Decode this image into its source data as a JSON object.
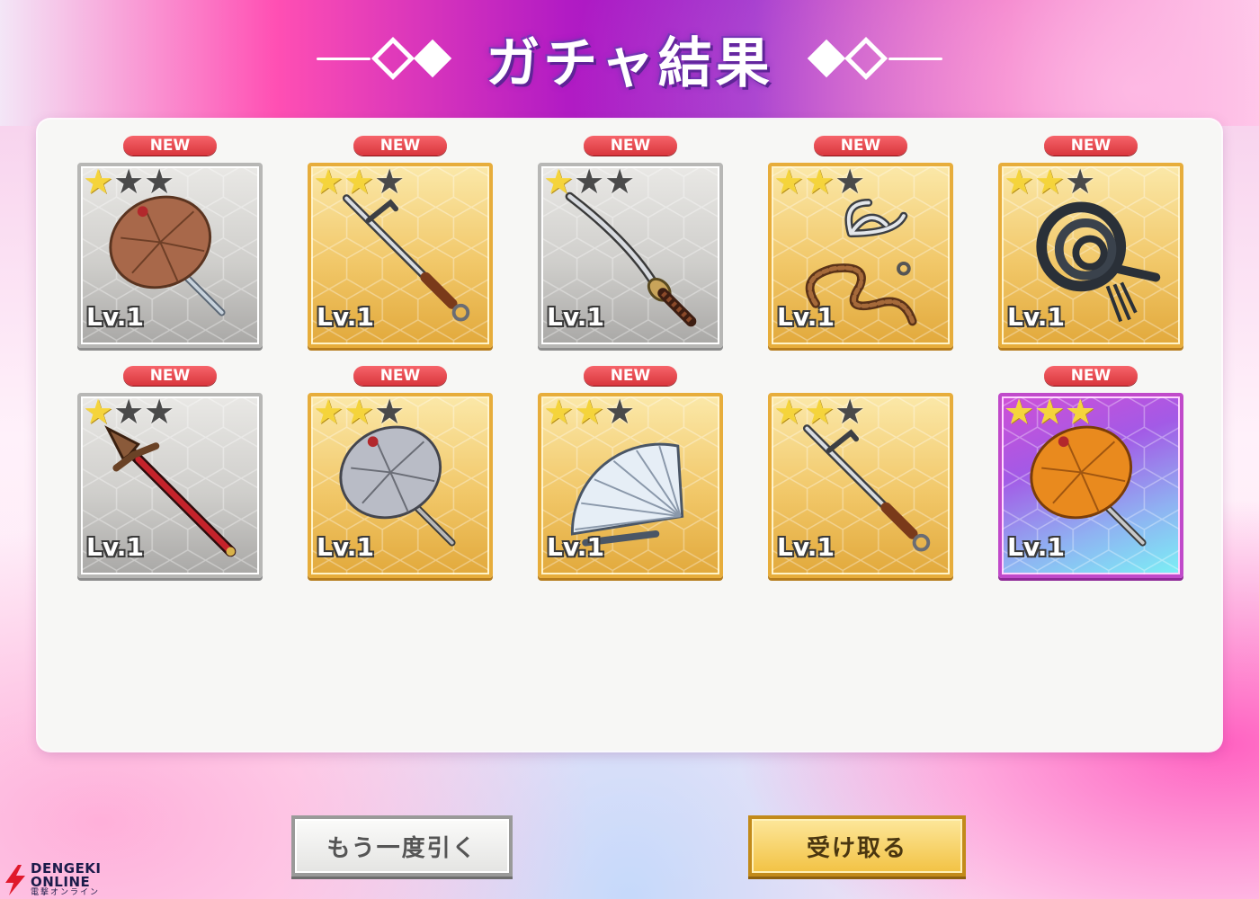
{
  "header": {
    "title": "ガチャ結果"
  },
  "cards": [
    {
      "new": "NEW",
      "stars_on": 1,
      "level": "Lv.1",
      "rarity": "gray",
      "icon": "brown-umbrella-icon"
    },
    {
      "new": "NEW",
      "stars_on": 2,
      "level": "Lv.1",
      "rarity": "gold",
      "icon": "jitte-icon"
    },
    {
      "new": "NEW",
      "stars_on": 1,
      "level": "Lv.1",
      "rarity": "gray",
      "icon": "katana-icon"
    },
    {
      "new": "NEW",
      "stars_on": 2,
      "level": "Lv.1",
      "rarity": "gold",
      "icon": "grappling-hook-icon"
    },
    {
      "new": "NEW",
      "stars_on": 2,
      "level": "Lv.1",
      "rarity": "gold",
      "icon": "whip-icon"
    },
    {
      "new": "NEW",
      "stars_on": 1,
      "level": "Lv.1",
      "rarity": "gray",
      "icon": "spear-icon"
    },
    {
      "new": "NEW",
      "stars_on": 2,
      "level": "Lv.1",
      "rarity": "gold",
      "icon": "gray-umbrella-icon"
    },
    {
      "new": "NEW",
      "stars_on": 2,
      "level": "Lv.1",
      "rarity": "gold",
      "icon": "folding-fan-icon"
    },
    {
      "new": "",
      "stars_on": 2,
      "level": "Lv.1",
      "rarity": "gold",
      "icon": "jitte-icon"
    },
    {
      "new": "NEW",
      "stars_on": 3,
      "level": "Lv.1",
      "rarity": "rainbow",
      "icon": "orange-umbrella-icon"
    }
  ],
  "stars_total": 3,
  "buttons": {
    "retry": "もう一度引く",
    "receive": "受け取る"
  },
  "logo": {
    "line1": "DENGEKI",
    "line2": "ONLINE",
    "line3": "電撃オンライン"
  },
  "colors": {
    "star_on": "#f5d43b",
    "star_off": "#4a4a4a",
    "new_badge": "#e0393f"
  }
}
